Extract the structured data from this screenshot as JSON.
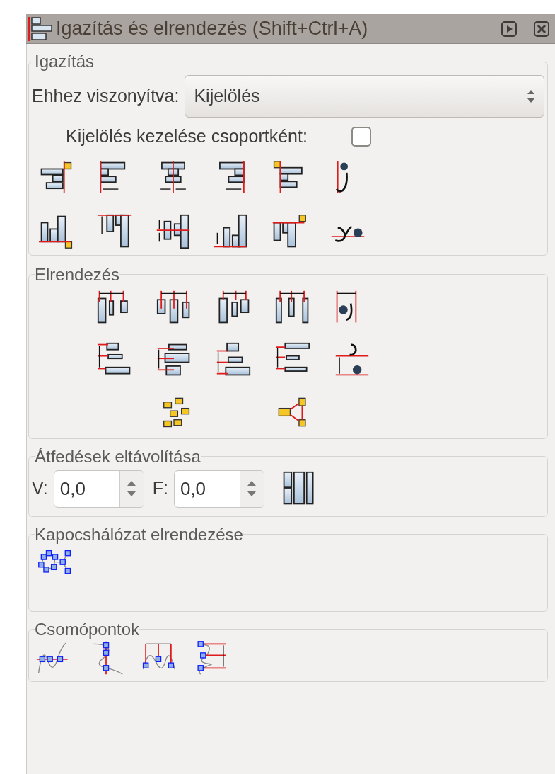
{
  "title": "Igazítás és elrendezés (Shift+Ctrl+A)",
  "align": {
    "legend": "Igazítás",
    "relative_label": "Ehhez viszonyítva:",
    "relative_value": "Kijelölés",
    "group_label": "Kijelölés kezelése csoportként:",
    "group_checked": false
  },
  "arrange": {
    "legend": "Elrendezés"
  },
  "overlap": {
    "legend": "Átfedések eltávolítása",
    "h_label": "V:",
    "h_value": "0,0",
    "v_label": "F:",
    "v_value": "0,0"
  },
  "connector": {
    "legend": "Kapocshálózat elrendezése"
  },
  "nodes": {
    "legend": "Csomópontok"
  }
}
